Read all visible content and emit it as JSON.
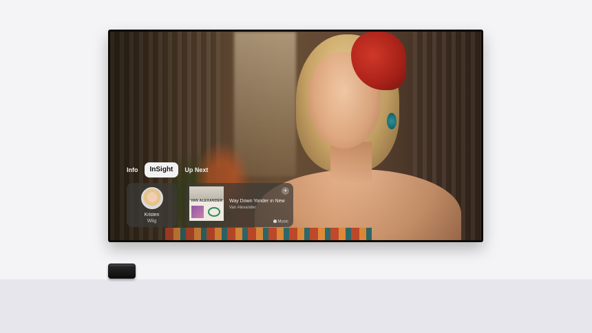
{
  "tabs": [
    {
      "label": "Info",
      "active": false
    },
    {
      "label": "InSight",
      "active": true
    },
    {
      "label": "Up Next",
      "active": false
    }
  ],
  "person": {
    "first_name": "Kristen",
    "last_name": "Wiig"
  },
  "song": {
    "title": "Way Down Yonder in New",
    "artist": "Van Alexander",
    "album_text": "VAN ALEXANDER",
    "service": "Music",
    "add_symbol": "+"
  },
  "icons": [
    "apple-icon",
    "plus-icon"
  ],
  "colors": {
    "active_tab_bg": "#f2f2f2",
    "card_bg": "rgba(60,58,55,0.72)"
  }
}
